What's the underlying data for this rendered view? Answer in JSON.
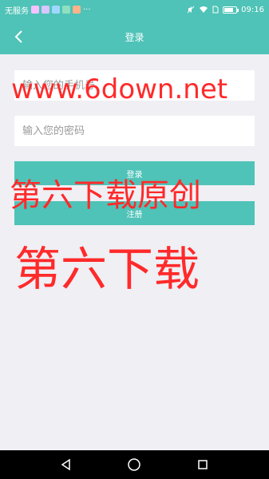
{
  "status_bar": {
    "carrier": "无服务",
    "more": "···",
    "time": "09:16",
    "battery_level": 0.8
  },
  "header": {
    "title": "登录",
    "back_icon": "chevron-left-icon"
  },
  "form": {
    "phone_placeholder": "输入您的手机号",
    "password_placeholder": "输入您的密码",
    "login_label": "登录",
    "register_label": "注册"
  },
  "watermark": {
    "line1": "www.6down.net",
    "line2": "第六下载原创",
    "line3": "第六下载"
  },
  "nav": {
    "back_icon": "triangle-back-icon",
    "home_icon": "circle-home-icon",
    "recents_icon": "square-recents-icon"
  },
  "colors": {
    "accent": "#4fc3b7",
    "watermark": "#ff2a2a",
    "background": "#efeff4"
  }
}
